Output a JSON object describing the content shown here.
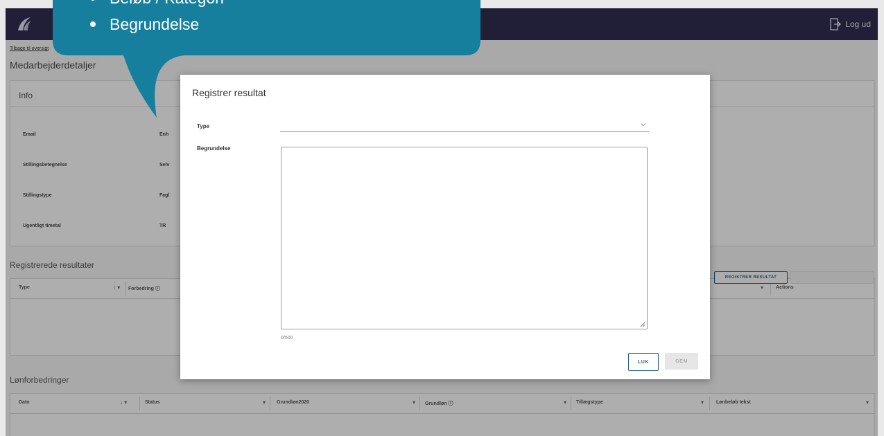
{
  "header": {
    "logout_label": "Log ud"
  },
  "page": {
    "back_link": "Tilbage til oversigt",
    "title": "Medarbejderdetaljer"
  },
  "info": {
    "title": "Info",
    "rows": [
      {
        "label": "Email",
        "value": "Enh"
      },
      {
        "label": "Stillingsbetegnelse",
        "value": "Selv"
      },
      {
        "label": "Stillingstype",
        "value": "Fagl"
      },
      {
        "label": "Ugentligt timetal",
        "value": "TR"
      }
    ]
  },
  "results": {
    "section_title": "Registrerede resultater",
    "register_button": "REGISTRER RESULTAT",
    "columns": {
      "type": "Type",
      "condition": "Forbedring ⓘ",
      "actions": "Actions"
    }
  },
  "salary": {
    "section_title": "Lønforbedringer",
    "columns": [
      "Dato",
      "Status",
      "Grundløn2020",
      "Grundløn ⓘ",
      "Tillægstype",
      "Lønbeløb tekst"
    ]
  },
  "modal": {
    "title": "Registrer resultat",
    "type_label": "Type",
    "type_value": "",
    "reason_label": "Begrundelse",
    "reason_value": "",
    "counter": "0/500",
    "close_button": "LUK",
    "save_button": "GEM"
  },
  "bubble": {
    "items": [
      "Beløb / Kategori",
      "Begrundelse"
    ]
  },
  "colors": {
    "topbar": "#2f2d50",
    "bubble": "#167f9e",
    "accent": "#2c5f8a"
  }
}
